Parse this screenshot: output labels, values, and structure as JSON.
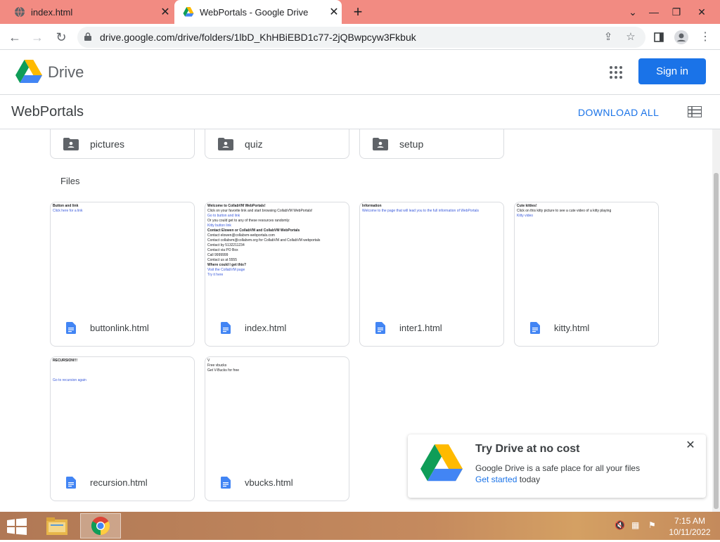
{
  "browser": {
    "tabs": [
      {
        "title": "index.html",
        "active": false
      },
      {
        "title": "WebPortals - Google Drive",
        "active": true
      }
    ],
    "url": "drive.google.com/drive/folders/1lbD_KhHBiEBD1c77-2jQBwpcyw3Fkbuk"
  },
  "drive": {
    "app_name": "Drive",
    "sign_in": "Sign in",
    "folder_title": "WebPortals",
    "download_all": "DOWNLOAD ALL",
    "folders": [
      "pictures",
      "quiz",
      "setup"
    ],
    "files_heading": "Files",
    "files": [
      {
        "name": "buttonlink.html",
        "preview": [
          {
            "text": "Button and link",
            "style": "b"
          },
          {
            "text": "Click here for a link",
            "style": "lnk"
          }
        ]
      },
      {
        "name": "index.html",
        "preview": [
          {
            "text": "Welcome to CollabVM WebPortals!",
            "style": "b"
          },
          {
            "text": "Click on your favorite link and start browsing CollabVM WebPortals!",
            "style": ""
          },
          {
            "text": "Go to button and link",
            "style": "lnk"
          },
          {
            "text": "Or you could get to any of these resources randomly:",
            "style": ""
          },
          {
            "text": "Kitty button link",
            "style": "lnk"
          },
          {
            "text": "Contact Elowen or CollabVM and CollabVM WebPortals",
            "style": "b"
          },
          {
            "text": "Contact elowen@collabvm-webportals.com",
            "style": ""
          },
          {
            "text": "Contact collabvm@collabvm.org for CollabVM and CollabVM webportals",
            "style": ""
          },
          {
            "text": "Contact by 5132211234",
            "style": ""
          },
          {
            "text": "Contact via PO Box",
            "style": ""
          },
          {
            "text": "Call 9999999",
            "style": ""
          },
          {
            "text": "Contact us at 5555",
            "style": ""
          },
          {
            "text": "Where could I get this?",
            "style": "b"
          },
          {
            "text": "Visit the CollabVM page",
            "style": "lnk"
          },
          {
            "text": "Try it here",
            "style": "lnk"
          }
        ]
      },
      {
        "name": "inter1.html",
        "preview": [
          {
            "text": "Information",
            "style": "b"
          },
          {
            "text": "Welcome to the page that will lead you to the full information of WebPortals",
            "style": "lnk"
          }
        ]
      },
      {
        "name": "kitty.html",
        "preview": [
          {
            "text": "Cute kitties!",
            "style": "b"
          },
          {
            "text": "Click on this kitty picture to see a cute video of a kitty playing",
            "style": ""
          },
          {
            "text": "Kitty video",
            "style": "lnk"
          }
        ]
      },
      {
        "name": "recursion.html",
        "preview": [
          {
            "text": "RECURSION!!!",
            "style": "b"
          },
          {
            "text": "",
            "style": ""
          },
          {
            "text": "",
            "style": ""
          },
          {
            "text": "",
            "style": ""
          },
          {
            "text": "                          Go to recursion again",
            "style": "lnk"
          }
        ]
      },
      {
        "name": "vbucks.html",
        "preview": [
          {
            "text": "V",
            "style": ""
          },
          {
            "text": "Free vbucks",
            "style": ""
          },
          {
            "text": "Get V-Bucks for free",
            "style": ""
          }
        ]
      }
    ]
  },
  "promo": {
    "title": "Try Drive at no cost",
    "body": "Google Drive is a safe place for all your files",
    "link": "Get started",
    "suffix": " today"
  },
  "taskbar": {
    "time": "7:15 AM",
    "date": "10/11/2022"
  },
  "colors": {
    "tabstrip": "#f28b82",
    "accent": "#1a73e8"
  }
}
